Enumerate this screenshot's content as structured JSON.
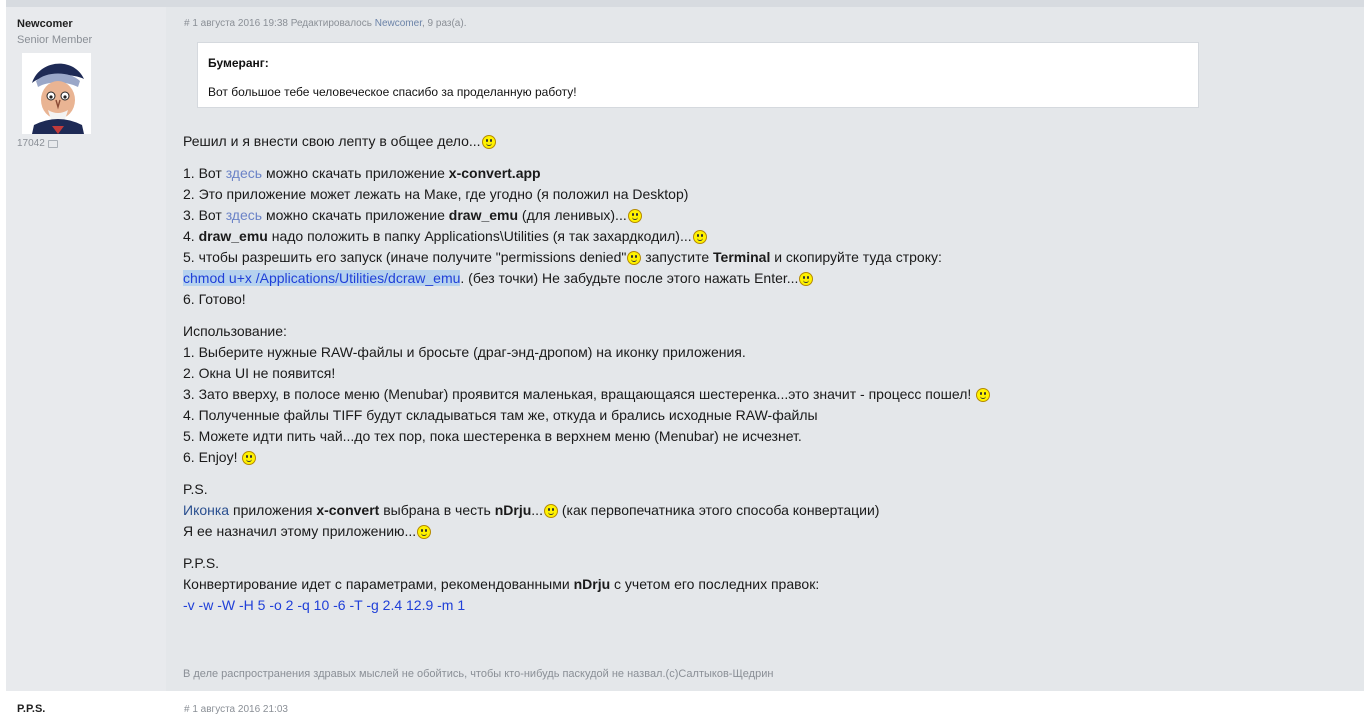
{
  "author": {
    "name": "Newcomer",
    "rank": "Senior Member",
    "post_count": "17042"
  },
  "meta": {
    "prefix": "# 1 августа 2016 19:38 Редактировалось ",
    "editor": "Newcomer",
    "suffix": ", 9 раз(а)."
  },
  "quote": {
    "author": "Бумеранг:",
    "text": "Вот большое тебе человеческое спасибо за проделанную работу!"
  },
  "content": {
    "intro": "Решил и я внести свою лепту в общее дело...",
    "step1_pre": "1. Вот ",
    "step1_link": "здесь",
    "step1_mid": " можно скачать приложение ",
    "step1_bold": "x-convert.app",
    "step2": "2. Это приложение может лежать на Маке, где угодно (я положил на Desktop)",
    "step3_pre": "3. Вот ",
    "step3_link": "здесь",
    "step3_mid": " можно скачать приложение ",
    "step3_bold": "draw_emu",
    "step3_post": " (для ленивых)...",
    "step4_pre": "4. ",
    "step4_bold": "draw_emu",
    "step4_post": " надо положить в папку Applications\\Utilities (я так захардкодил)...",
    "step5_pre": "5. чтобы разрешить его запуск (иначе получите \"permissions denied\"",
    "step5_mid": " запустите ",
    "step5_bold": "Terminal",
    "step5_post": " и скопируйте туда строку:",
    "command": "chmod u+x /Applications/Utilities/dcraw_emu",
    "command_post": ". (без точки) Не забудьте после этого нажать Enter...",
    "step6": "6. Готово!",
    "usage_title": "Использование:",
    "usage1": "1. Выберите нужные RAW-файлы и бросьте (драг-энд-дропом) на иконку приложения.",
    "usage2": "2. Окна UI не появится!",
    "usage3": "3. Зато вверху, в полосе меню (Menubar) проявится маленькая, вращающаяся шестеренка...это значит - процесс пошел! ",
    "usage4": "4. Полученные файлы TIFF будут складываться там же, откуда и брались исходные RAW-файлы",
    "usage5": "5. Можете идти пить чай...до тех пор, пока шестеренка в верхнем меню (Menubar) не исчезнет.",
    "usage6": "6. Enjoy! ",
    "ps_title": "P.S.",
    "ps_link": "Иконка",
    "ps_mid": " приложения ",
    "ps_bold1": "x-convert",
    "ps_mid2": " выбрана в честь ",
    "ps_bold2": "nDrju",
    "ps_dots": "...",
    "ps_post": " (как первопечатника этого способа конвертации)",
    "ps_line2": "Я ее назначил этому приложению...",
    "pps_title": "P.P.S.",
    "pps_pre": "Конвертирование идет с параметрами, рекомендованными ",
    "pps_bold": "nDrju",
    "pps_post": " с учетом его последних правок:",
    "params": "-v -w -W -H 5 -o 2 -q 10 -6 -T -g 2.4 12.9 -m 1"
  },
  "signature": "В деле распространения здравых мыслей не обойтись, чтобы кто-нибудь паскудой не назвал.(c)Салтыков-Щедрин",
  "next_post": {
    "author": "P.P.S.",
    "meta": "# 1 августа 2016 21:03"
  },
  "colors": {
    "post_bg": "#e4e7ea",
    "link": "#6b83c7",
    "code_blue": "#1f3fd8",
    "highlight": "#b6d2ee",
    "smiley": "#fff200"
  },
  "icons": {
    "smiley": "smiley-icon",
    "post_count": "speech-bubble-icon"
  }
}
